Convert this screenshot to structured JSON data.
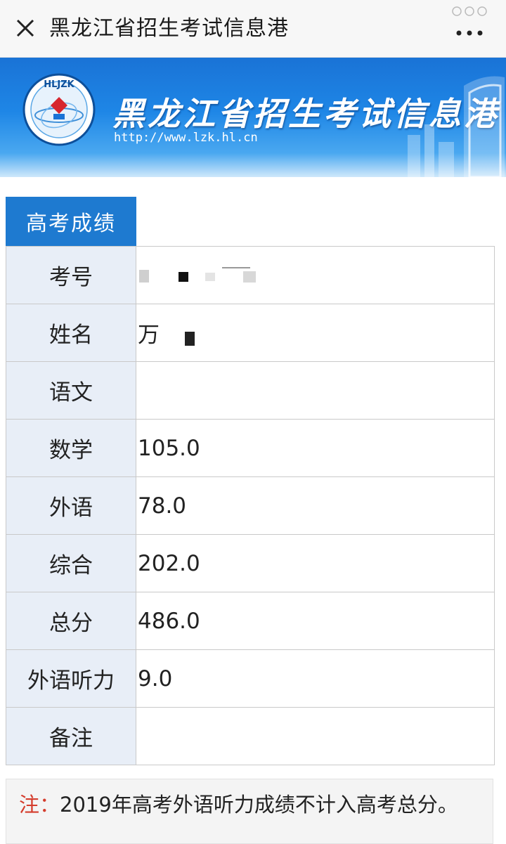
{
  "topbar": {
    "title": "黑龙江省招生考试信息港",
    "close_icon": "close-icon",
    "more_icon": "more-dots-icon"
  },
  "banner": {
    "logo_text": "HLJZK",
    "title": "黑龙江省招生考试信息港",
    "url": "http://www.lzk.hl.cn"
  },
  "tab": {
    "label": "高考成绩"
  },
  "scores": [
    {
      "label": "考号",
      "value": ""
    },
    {
      "label": "姓名",
      "value": "万"
    },
    {
      "label": "语文",
      "value": ""
    },
    {
      "label": "数学",
      "value": "105.0"
    },
    {
      "label": "外语",
      "value": "78.0"
    },
    {
      "label": "综合",
      "value": "202.0"
    },
    {
      "label": "总分",
      "value": "486.0"
    },
    {
      "label": "外语听力",
      "value": "9.0"
    },
    {
      "label": "备注",
      "value": ""
    }
  ],
  "note": {
    "prefix": "注：",
    "text": "2019年高考外语听力成绩不计入高考总分。"
  },
  "colors": {
    "accent": "#1e7ad0",
    "label_bg": "#e8eef7",
    "note_prefix": "#d43c2c"
  }
}
